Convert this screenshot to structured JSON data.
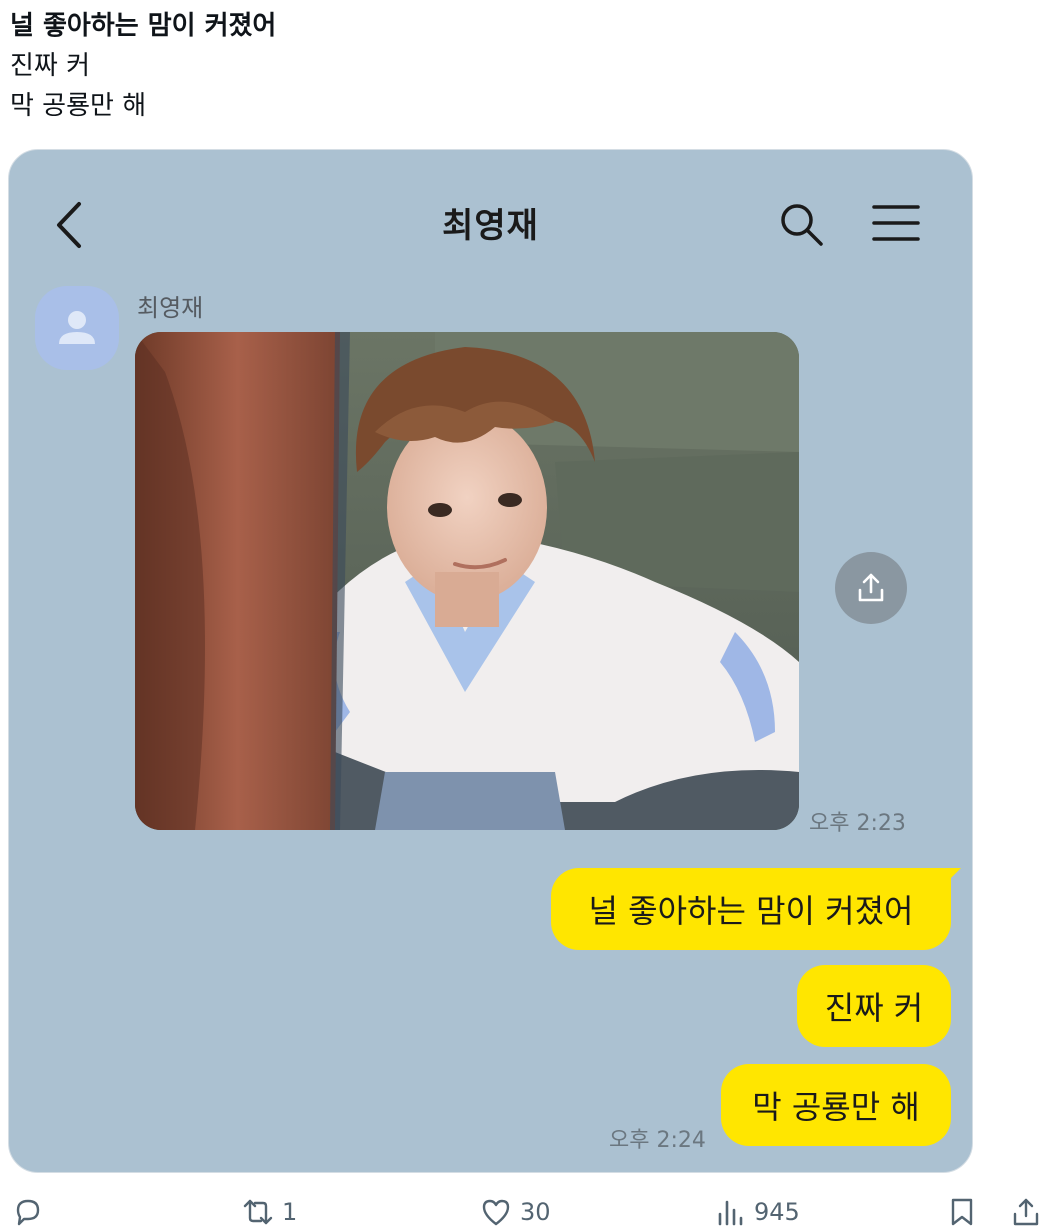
{
  "post": {
    "lines": [
      "널 좋아하는 맘이 커졌어",
      "진짜 커",
      "막 공룡만 해"
    ]
  },
  "chat": {
    "title": "최영재",
    "sender_name": "최영재",
    "photo_time": "오후 2:23",
    "messages": [
      {
        "text": "널 좋아하는 맘이 커졌어"
      },
      {
        "text": "진짜 커"
      },
      {
        "text": "막 공룡만 해"
      }
    ],
    "last_time": "오후 2:24",
    "bubble_color": "#ffe600",
    "background_color": "#abc1d1"
  },
  "actions": {
    "reply_count": "",
    "retweet_count": "1",
    "like_count": "30",
    "view_count": "945"
  },
  "icons": [
    "back-icon",
    "search-icon",
    "menu-icon",
    "avatar-person-icon",
    "share-icon",
    "reply-icon",
    "retweet-icon",
    "like-icon",
    "views-icon",
    "bookmark-icon",
    "share-post-icon"
  ]
}
